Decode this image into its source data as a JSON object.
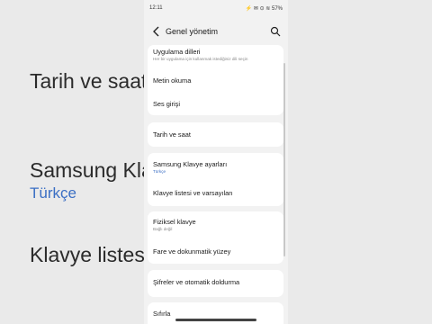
{
  "status_bar": {
    "time": "12:11",
    "icons": "⚡ ✉ ⊙ ≋ 57%"
  },
  "header": {
    "title": "Genel yönetim"
  },
  "items": [
    {
      "label": "Uygulama dilleri",
      "sub": "Her bir uygulama için kullanmak istediğiniz dili seçin"
    },
    {
      "label": "Metin okuma"
    },
    {
      "label": "Ses girişi"
    },
    {
      "label": "Tarih ve saat"
    },
    {
      "label": "Samsung Klavye ayarları",
      "sub": "Türkçe"
    },
    {
      "label": "Klavye listesi ve varsayılan"
    },
    {
      "label": "Fiziksel klavye",
      "sub": "Bağlı değil"
    },
    {
      "label": "Fare ve dokunmatik yüzey"
    },
    {
      "label": "Şifreler ve otomatik doldurma"
    },
    {
      "label": "Sıfırla"
    }
  ],
  "background": {
    "line1": "Tarih ve saat",
    "line2": "Samsung Klavye ayarları",
    "line2_sub": "Türkçe",
    "line3": "Klavye listesi ve varsayılan"
  },
  "colors": {
    "accent_blue": "#3b6fc4",
    "card": "#ffffff",
    "surface": "#f2f2f2"
  }
}
